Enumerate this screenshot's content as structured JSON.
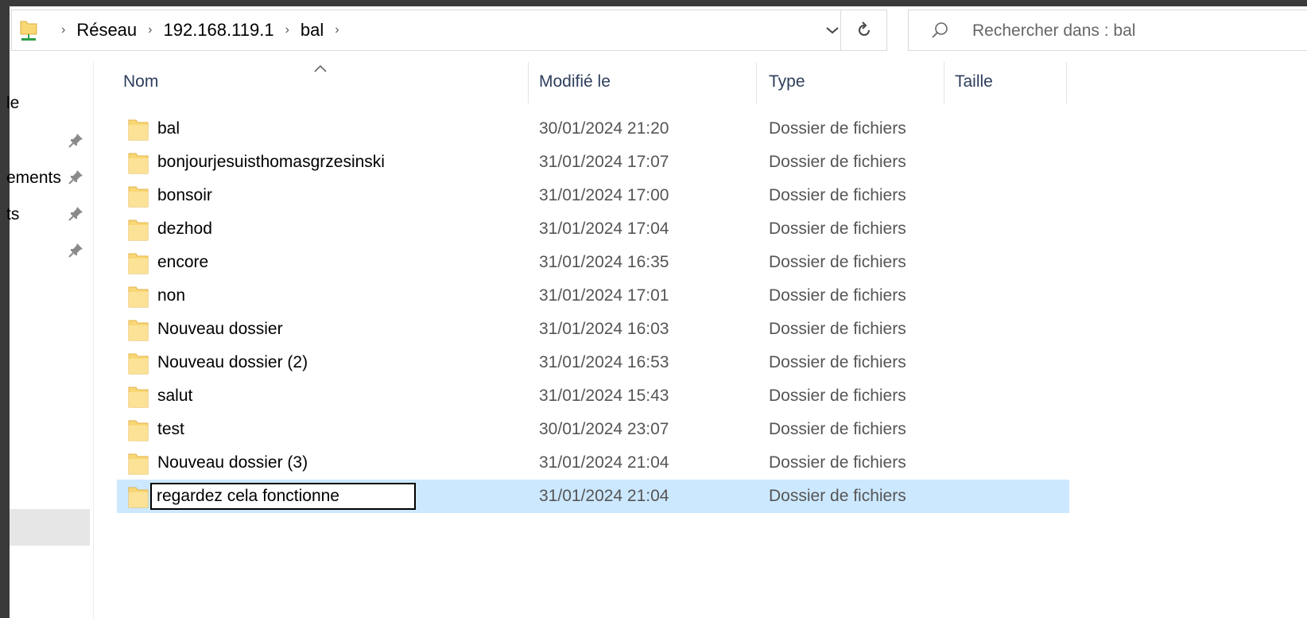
{
  "address": {
    "breadcrumbs": [
      "Réseau",
      "192.168.119.1",
      "bal"
    ],
    "separator": "›"
  },
  "search": {
    "placeholder": "Rechercher dans : bal"
  },
  "nav": {
    "items": [
      {
        "label": "le",
        "pinned": false
      },
      {
        "label": "",
        "pinned": true
      },
      {
        "label": "ements",
        "pinned": true
      },
      {
        "label": "ts",
        "pinned": true
      },
      {
        "label": "",
        "pinned": true
      }
    ]
  },
  "columns": {
    "name": "Nom",
    "modified": "Modifié le",
    "type": "Type",
    "size": "Taille"
  },
  "files": [
    {
      "name": "bal",
      "modified": "30/01/2024 21:20",
      "type": "Dossier de fichiers"
    },
    {
      "name": "bonjourjesuisthomasgrzesinski",
      "modified": "31/01/2024 17:07",
      "type": "Dossier de fichiers"
    },
    {
      "name": "bonsoir",
      "modified": "31/01/2024 17:00",
      "type": "Dossier de fichiers"
    },
    {
      "name": "dezhod",
      "modified": "31/01/2024 17:04",
      "type": "Dossier de fichiers"
    },
    {
      "name": "encore",
      "modified": "31/01/2024 16:35",
      "type": "Dossier de fichiers"
    },
    {
      "name": "non",
      "modified": "31/01/2024 17:01",
      "type": "Dossier de fichiers"
    },
    {
      "name": "Nouveau dossier",
      "modified": "31/01/2024 16:03",
      "type": "Dossier de fichiers"
    },
    {
      "name": "Nouveau dossier (2)",
      "modified": "31/01/2024 16:53",
      "type": "Dossier de fichiers"
    },
    {
      "name": "salut",
      "modified": "31/01/2024 15:43",
      "type": "Dossier de fichiers"
    },
    {
      "name": "test",
      "modified": "30/01/2024 23:07",
      "type": "Dossier de fichiers"
    },
    {
      "name": "Nouveau dossier (3)",
      "modified": "31/01/2024 21:04",
      "type": "Dossier de fichiers"
    }
  ],
  "renaming": {
    "value": "regardez cela fonctionne",
    "modified": "31/01/2024 21:04",
    "type": "Dossier de fichiers"
  },
  "colors": {
    "selection": "#cce8ff",
    "folder": "#f8d775",
    "folder_dark": "#e8b84a",
    "header_text": "#2d3e5c"
  }
}
